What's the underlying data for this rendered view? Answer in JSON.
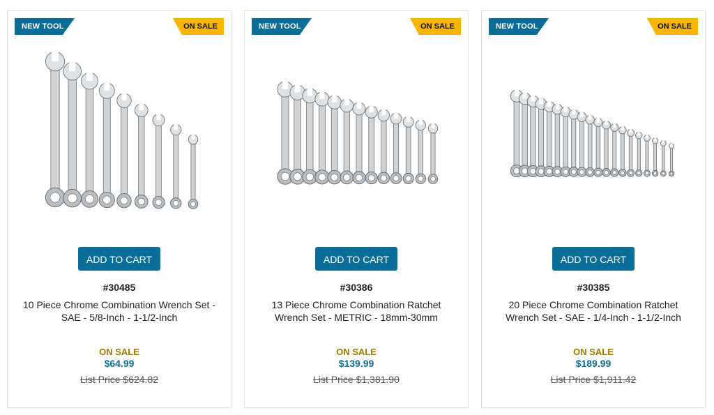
{
  "products": [
    {
      "badge_new": "NEW TOOL",
      "badge_sale": "ON SALE",
      "image_icon": "combination-wrench-set-image",
      "wrench_count": 9,
      "cart_label": "ADD TO CART",
      "sku": "#30485",
      "title": "10 Piece Chrome Combination Wrench Set - SAE - 5/8-Inch - 1-1/2-Inch",
      "sale_label": "ON SALE",
      "price": "$64.99",
      "list_price": "List Price $624.82"
    },
    {
      "badge_new": "NEW TOOL",
      "badge_sale": "ON SALE",
      "image_icon": "ratchet-wrench-set-image",
      "wrench_count": 13,
      "cart_label": "ADD TO CART",
      "sku": "#30386",
      "title": "13 Piece Chrome Combination Ratchet Wrench Set - METRIC - 18mm-30mm",
      "sale_label": "ON SALE",
      "price": "$139.99",
      "list_price": "List Price $1,381.90"
    },
    {
      "badge_new": "NEW TOOL",
      "badge_sale": "ON SALE",
      "image_icon": "ratchet-wrench-set-image",
      "wrench_count": 20,
      "cart_label": "ADD TO CART",
      "sku": "#30385",
      "title": "20 Piece Chrome Combination Ratchet Wrench Set - SAE - 1/4-Inch - 1-1/2-Inch",
      "sale_label": "ON SALE",
      "price": "$189.99",
      "list_price": "List Price $1,911.42"
    }
  ],
  "colors": {
    "brand_blue": "#0b6e99",
    "sale_yellow": "#f7b500",
    "sale_text": "#a07800"
  }
}
